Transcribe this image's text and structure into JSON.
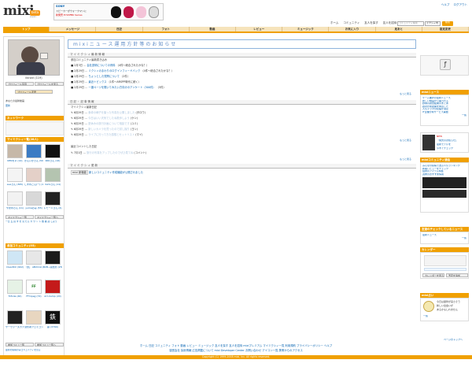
{
  "header": {
    "logo": "mixi",
    "logo_badge": "beta",
    "logo_sub": "Japan",
    "banner": {
      "brand": "SONY",
      "line1": "スピーカーがウォークマンに",
      "line2": "新発売 E720FBK Series"
    },
    "top_links": [
      "ヘルプ",
      "ログアウト"
    ],
    "nav_icons": [
      "ホーム",
      "コミュニティ",
      "友人を探す",
      "友人を招待"
    ],
    "search": {
      "placeholder": "コミュニティ検索",
      "scope": "ミクシィ内",
      "button": "検索"
    }
  },
  "tabs": [
    "トップ",
    "メッセージ",
    "日記",
    "フォト",
    "動画",
    "レビュー",
    "ミュージック",
    "お気に入り",
    "足あと",
    "設定変更"
  ],
  "active_tab": 0,
  "colors": {
    "accent": "#f0a000",
    "link": "#0060b0",
    "panel": "#f6e4bc"
  },
  "left": {
    "username": "ikinari (119)",
    "profile_buttons": [
      "プロフィール写真",
      "プロフィールを見る"
    ],
    "profile_edit": "プロフィール変更",
    "visitor_label": "あなたの最新動画",
    "update_link": "更新",
    "diary_header": "ネットワーク",
    "friends_header": "マイミクシィ一覧(28人)",
    "friends": [
      {
        "name": "KENちゃ (14)"
      },
      {
        "name": "かんいかさん (50)"
      },
      {
        "name": "KIKIさん (16)"
      },
      {
        "name": "eveさん (365)"
      },
      {
        "name": "しずねこ(ぷー) (100)"
      },
      {
        "name": "mimiさん (11)"
      },
      {
        "name": "やまねさん (11)"
      },
      {
        "name": "yumaのみ (55)"
      },
      {
        "name": "トモーニさん (4)"
      }
    ],
    "friends_buttons": [
      "マイミクシィ一覧",
      "マイミクシィ一覧へ"
    ],
    "friends_more": "一日 五 頁 す を 見 たら カ ウ ン ト 数 確 認 しよう",
    "comm_header": "参加コミュニティ(55)",
    "communities": [
      {
        "name": "ClearPoll (902)"
      },
      {
        "name": "「食」 AB2mixi (27)"
      },
      {
        "name": "B2B~感想文 (2500)"
      },
      {
        "name": "Trifolia (46)"
      },
      {
        "name": "FFmpeg (72)"
      },
      {
        "name": "Art-Camp (20)"
      },
      {
        "name": "サーヴァーズカフェ (351)"
      },
      {
        "name": "潜伏者フェミコンファ (21)"
      },
      {
        "name": "鉄 (3790)"
      }
    ],
    "comm_buttons": [
      "参加コミュ一覧",
      "参加コミュ一覧へ"
    ],
    "comm_more": "最新の投稿のみコミュニティを見る"
  },
  "main": {
    "notice_title": "mixiニュース運用方針等のお知らせ",
    "sec1_header": "マイミクシィ最新情報",
    "sec1_sub": "参加コミュニティ最新書き込み",
    "sec1_rows": [
      {
        "date": "2月3日",
        "link": "会社説明についての資料",
        "info": "（4件〜総合されたかな？）"
      },
      {
        "date": "2月29日",
        "link": "ミクシィのまわりのログインフィードバック",
        "info": "（4件〜総合されたかな？）"
      },
      {
        "date": "2月29日",
        "link": "ちょっとした質問について",
        "info": "（2件）"
      },
      {
        "date": "2月29日",
        "link": "最近トピックス",
        "info": "（1件〜ARSPP時代に続く）"
      },
      {
        "date": "2月29日",
        "link": "一度ページを開いてみたい方向けのアンケート（500件）",
        "info": "（5件）"
      }
    ],
    "sec1_more": "もっと見る",
    "sec2_header": "日記・記事情報",
    "sec2_sub": "マイミクシィ最新日記",
    "sec2_rows": [
      {
        "date": "6月29日",
        "link": "食卓の様子を撮った写真を公開しました",
        "info": "(タロウ)"
      },
      {
        "date": "6月29日",
        "link": "今日はいい天気でしたね散歩しよう",
        "info": "(ケン)"
      },
      {
        "date": "6月29日",
        "link": "夏休みの旅行計画について相談です",
        "info": "(ユミ)"
      },
      {
        "date": "6月29日",
        "link": "新しいカメラを買ったので試し撮り",
        "info": "(ヨシ)"
      },
      {
        "date": "6月29日",
        "link": "ライブに行ってきた感想とセットリスト",
        "info": "(マイ)"
      }
    ],
    "sec2_more": "もっと見る",
    "sec3_sub": "最近コメントした日記",
    "sec3_row": {
      "date": "7月1日",
      "link": "旅行の写真をアップしたのでぜひ見てね",
      "info": "(コメント)"
    },
    "sec3_more": "もっと見る",
    "sec4_header": "マイミクシィ更新",
    "sec4_row": {
      "tag": "mixi 新機能",
      "link": "新しいコミュニティ作成機能が公開されました"
    }
  },
  "right": {
    "news_header": "mixiニュース",
    "news_items": [
      "ゲーム業界の最新ニュース",
      "新しい映画が公開される",
      "野球の試合結果のまとめ",
      "政府が新政策を発表した",
      "人気ドラマの続編が決定",
      "IT企業が新サービス開始"
    ],
    "news_more": "一覧",
    "label_new": "NEW",
    "ad_text": [
      "「発売のお知らせ」",
      "最新モデルを",
      "今すぐチェック"
    ],
    "review_header": "mixiコミュニティ通信",
    "review_items": [
      "みんなの投稿で選ぶ人気ランキング",
      "新着レビューをチェック",
      "話題のアイテム特集",
      "週末のおすすめ情報"
    ],
    "music_header": "友達のチェックしているニュース",
    "music_items": [
      "最新ニュース",
      "一覧"
    ],
    "calendar_header": "カレンダー",
    "calendar_buttons": [
      "カレンダーを見る",
      "予定を追加"
    ],
    "profile_header": "mixi占い",
    "profile_text": [
      "今日は運勢が良さそう",
      "新しい出会いが",
      "あるかもしれません"
    ],
    "profile_more": "一覧",
    "page_more": "ページのトップへ"
  },
  "footer": {
    "links1": "ホーム  日記  コミュニティ  フォト  動画  レビュー  ミュージック  友人を探す  友人を招待  mixiプレミアム  マイミクシィ一覧  利用規約  プライバシーポリシー  ヘルプ",
    "links2": "運営会社  採用情報  広告掲載について  mixi Developer Center  お問い合わせ  アイコン一覧  携帯からのアクセス",
    "copyright": "Copyright (C) 1999-2008 mixi, Inc. All rights reserved."
  }
}
